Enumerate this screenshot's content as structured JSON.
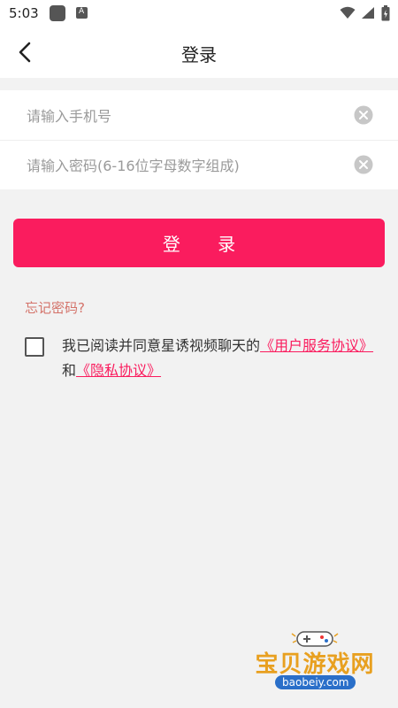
{
  "status_bar": {
    "time": "5:03"
  },
  "header": {
    "title": "登录"
  },
  "form": {
    "phone_placeholder": "请输入手机号",
    "phone_value": "",
    "password_placeholder": "请输入密码(6-16位字母数字组成)",
    "password_value": ""
  },
  "login_button_label": "登 录",
  "forgot_password": "忘记密码?",
  "agreement": {
    "checked": false,
    "prefix": "我已阅读并同意星诱视频聊天的",
    "terms_link": "《用户服务协议》",
    "conjunction": "和",
    "privacy_link": "《隐私协议》"
  },
  "watermark": {
    "name": "宝贝游戏网",
    "url": "baobeiy.com"
  },
  "colors": {
    "accent": "#fa1c5e",
    "forgot_link": "#d4736a",
    "background": "#f2f2f2"
  },
  "icons": [
    "back-arrow-icon",
    "clear-icon",
    "wifi-icon",
    "signal-icon",
    "battery-icon"
  ]
}
